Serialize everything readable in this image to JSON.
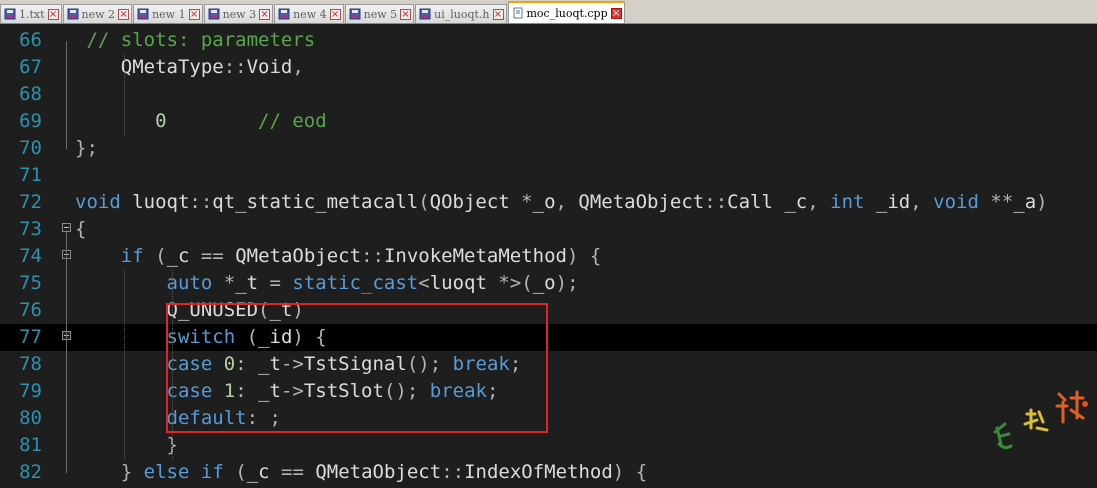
{
  "tabs": [
    {
      "label": "1.txt",
      "active": false
    },
    {
      "label": "new 2",
      "active": false
    },
    {
      "label": "new 1",
      "active": false
    },
    {
      "label": "new 3",
      "active": false
    },
    {
      "label": "new 4",
      "active": false
    },
    {
      "label": "new 5",
      "active": false
    },
    {
      "label": "ui_luoqt.h",
      "active": false
    },
    {
      "label": "moc_luoqt.cpp",
      "active": true
    }
  ],
  "editor": {
    "current_line": 77,
    "lines": [
      {
        "n": "66",
        "text": " // slots: parameters"
      },
      {
        "n": "67",
        "text": "    QMetaType::Void,"
      },
      {
        "n": "68",
        "text": ""
      },
      {
        "n": "69",
        "text": "       0        // eod"
      },
      {
        "n": "70",
        "text": "};"
      },
      {
        "n": "71",
        "text": ""
      },
      {
        "n": "72",
        "text": "void luoqt::qt_static_metacall(QObject *_o, QMetaObject::Call _c, int _id, void **_a)"
      },
      {
        "n": "73",
        "text": "{"
      },
      {
        "n": "74",
        "text": "    if (_c == QMetaObject::InvokeMetaMethod) {"
      },
      {
        "n": "75",
        "text": "        auto *_t = static_cast<luoqt *>(_o);"
      },
      {
        "n": "76",
        "text": "        Q_UNUSED(_t)"
      },
      {
        "n": "77",
        "text": "        switch (_id) {"
      },
      {
        "n": "78",
        "text": "        case 0: _t->TstSignal(); break;"
      },
      {
        "n": "79",
        "text": "        case 1: _t->TstSlot(); break;"
      },
      {
        "n": "80",
        "text": "        default: ;"
      },
      {
        "n": "81",
        "text": "        }"
      },
      {
        "n": "82",
        "text": "    } else if (_c == QMetaObject::IndexOfMethod) {"
      }
    ]
  },
  "colors": {
    "background": "#1e1e1e",
    "line_number": "#2b91af",
    "keyword": "#569cd6",
    "comment": "#57a64a",
    "number": "#b5cea8",
    "highlight_box": "#e0242c"
  },
  "watermark": {
    "text": "夏 沫 林",
    "kind": "seal"
  }
}
